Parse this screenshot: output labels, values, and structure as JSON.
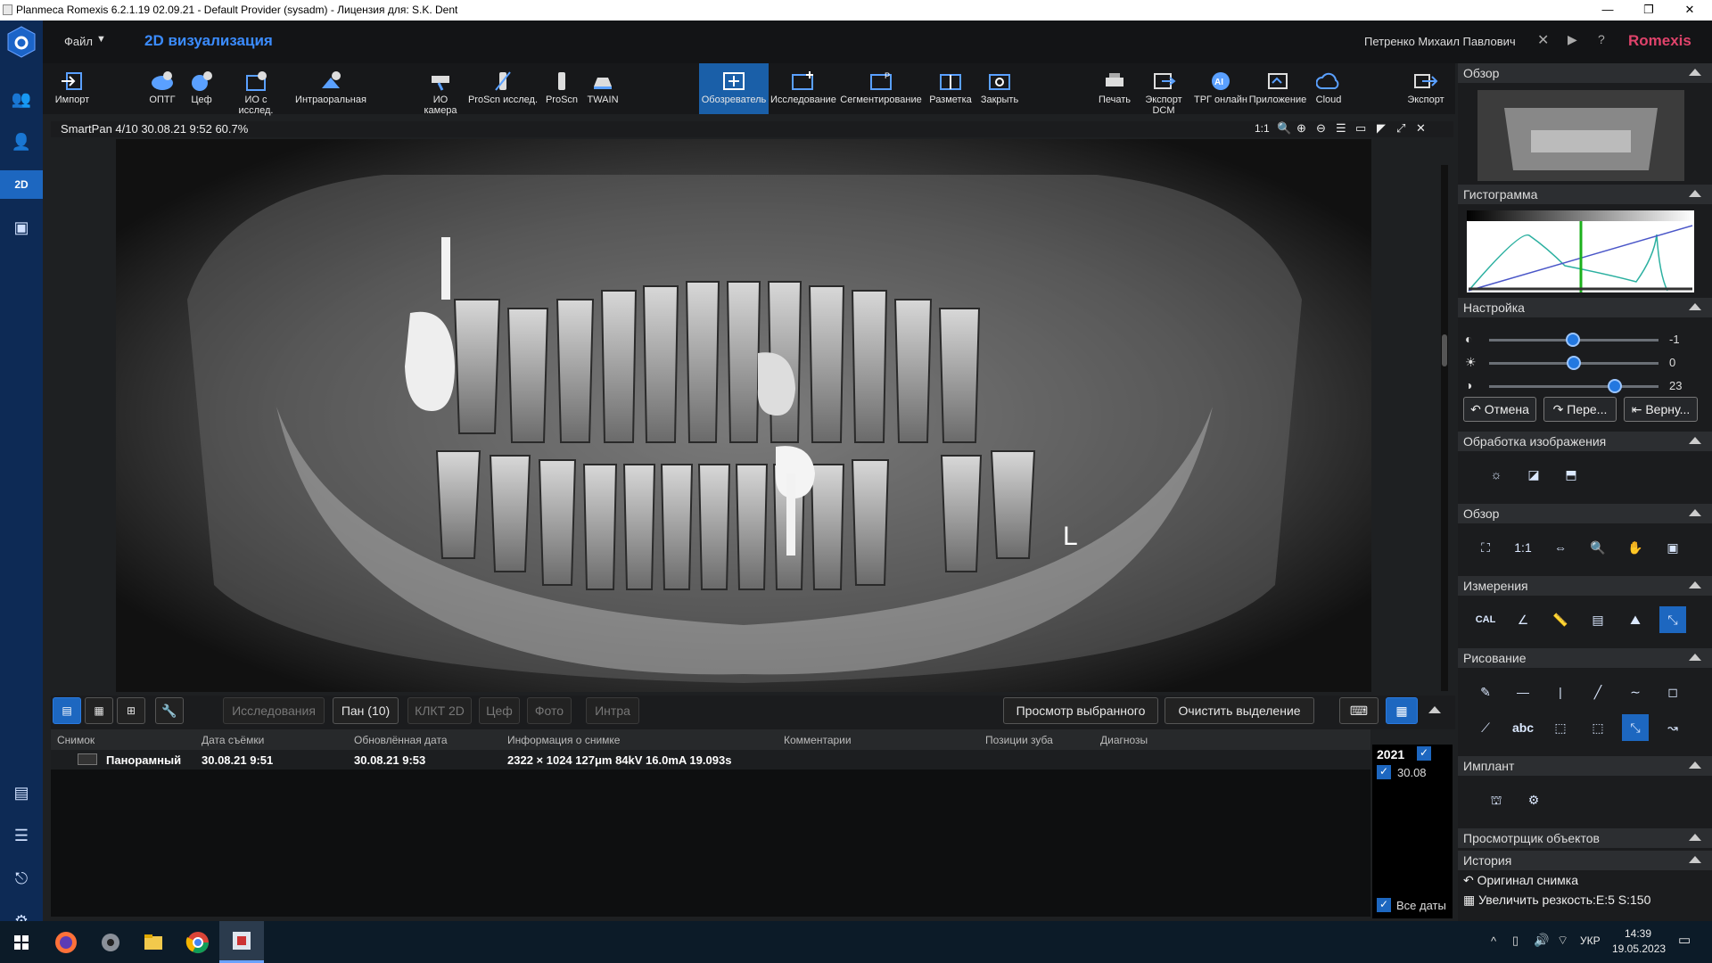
{
  "window": {
    "title": "Planmeca Romexis 6.2.1.19 02.09.21 - Default Provider (sysadm) - Лицензия для: S.K. Dent",
    "min": "—",
    "max": "❐",
    "close": "✕"
  },
  "app": {
    "menu_label": "Файл",
    "section_title": "2D визуализация",
    "user": "Петренко Михаил Павлович",
    "brand": "Romexis"
  },
  "toolbar": [
    {
      "label": "Импорт"
    },
    {
      "label": "ОПТГ"
    },
    {
      "label": "Цеф"
    },
    {
      "label": "ИО с исслед."
    },
    {
      "label": "Интраоральная"
    },
    {
      "label": "ИО камера"
    },
    {
      "label": "ProScn исслед."
    },
    {
      "label": "ProScn"
    },
    {
      "label": "TWAIN"
    },
    {
      "label": "Обозреватель"
    },
    {
      "label": "Исследование"
    },
    {
      "label": "Сегментирование"
    },
    {
      "label": "Разметка"
    },
    {
      "label": "Закрыть"
    },
    {
      "label": "Печать"
    },
    {
      "label": "Экспорт DCM"
    },
    {
      "label": "ТРГ онлайн"
    },
    {
      "label": "Приложение"
    },
    {
      "label": "Cloud"
    },
    {
      "label": "Экспорт"
    }
  ],
  "viewer": {
    "info": "SmartPan 4/10  30.08.21 9:52   60.7%",
    "scale": "1:1",
    "marker": "L"
  },
  "bottom_tabs": {
    "studies": "Исследования",
    "pan": "Пан (10)",
    "cbct": "КЛКТ 2D",
    "ceph": "Цеф",
    "photo": "Фото",
    "intra": "Интра",
    "view_selected": "Просмотр выбранного",
    "clear_selection": "Очистить выделение"
  },
  "table": {
    "headers": [
      "Снимок",
      "Дата съёмки",
      "Обновлённая дата",
      "Информация о снимке",
      "Комментарии",
      "Позиции зуба",
      "Диагнозы"
    ],
    "rows": [
      [
        "Панорамный",
        "30.08.21 9:51",
        "30.08.21 9:53",
        "2322 × 1024 127μm 84kV 16.0mA 19.093s",
        "",
        "",
        ""
      ]
    ]
  },
  "dates": {
    "year": "2021",
    "day": "30.08",
    "all": "Все даты"
  },
  "right_panel": {
    "overview": "Обзор",
    "histogram": "Гистограмма",
    "adjust": "Настройка",
    "adjust_values": {
      "contrast": -1,
      "brightness": 0,
      "gamma": 23
    },
    "undo": "Отмена",
    "redo": "Пере...",
    "revert": "Верну...",
    "processing": "Обработка изображения",
    "view": "Обзор",
    "measure": "Измерения",
    "cal": "CAL",
    "draw": "Рисование",
    "abc": "abc",
    "implant": "Имплант",
    "objects": "Просмотрщик объектов",
    "history": "История",
    "history_items": [
      "Оригинал снимка",
      "Увеличить резкость:E:5 S:150"
    ]
  },
  "taskbar": {
    "lang": "УКР",
    "time": "14:39",
    "date": "19.05.2023"
  },
  "colors": {
    "accent": "#1d67c0",
    "brand": "#e0436b",
    "nav": "#0d2a55"
  }
}
